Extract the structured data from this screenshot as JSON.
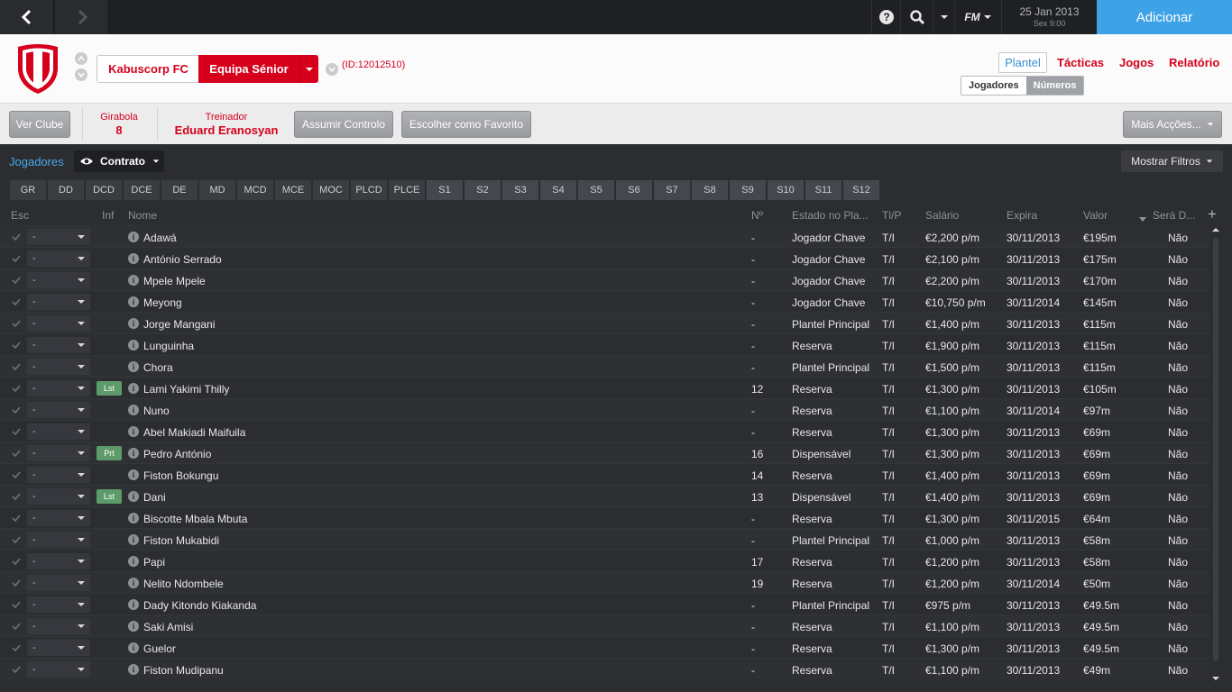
{
  "topbar": {
    "help_icon": "question-icon",
    "search_icon": "search-icon",
    "fm_label": "FM",
    "date": "25 Jan 2013",
    "day_time": "Sex 9:00",
    "add_label": "Adicionar"
  },
  "club": {
    "name": "Kabuscorp FC",
    "team": "Equipa Sénior",
    "id": "(ID:12012510)",
    "tabs": [
      "Plantel",
      "Tácticas",
      "Jogos",
      "Relatório"
    ],
    "subtabs": [
      "Jogadores",
      "Números"
    ]
  },
  "info": {
    "ver_clube": "Ver Clube",
    "league_label": "Girabola",
    "league_value": "8",
    "manager_label": "Treinador",
    "manager_value": "Eduard Eranosyan",
    "assume": "Assumir Controlo",
    "favourite": "Escolher como Favorito",
    "more": "Mais Acções..."
  },
  "filters": {
    "view_label": "Jogadores",
    "view_select": "Contrato",
    "show_filters": "Mostrar Filtros",
    "positions": [
      "GR",
      "DD",
      "DCD",
      "DCE",
      "DE",
      "MD",
      "MCD",
      "MCE",
      "MOC",
      "PLCD",
      "PLCE"
    ],
    "slots": [
      "S1",
      "S2",
      "S3",
      "S4",
      "S5",
      "S6",
      "S7",
      "S8",
      "S9",
      "S10",
      "S11",
      "S12"
    ]
  },
  "table": {
    "headers": {
      "esc": "Esc",
      "inf": "Inf",
      "name": "Nome",
      "num": "Nº",
      "status": "Estado no Pla...",
      "tlp": "Tl/P",
      "salary": "Salário",
      "expires": "Expira",
      "value": "Valor",
      "future": "Será D..."
    },
    "rows": [
      {
        "sel": "-",
        "badge": "",
        "name": "Adawá",
        "num": "-",
        "status": "Jogador Chave",
        "tlp": "T/I",
        "salary": "€2,200 p/m",
        "expires": "30/11/2013",
        "value": "€195m",
        "future": "Não"
      },
      {
        "sel": "-",
        "badge": "",
        "name": "António Serrado",
        "num": "-",
        "status": "Jogador Chave",
        "tlp": "T/I",
        "salary": "€2,100 p/m",
        "expires": "30/11/2013",
        "value": "€175m",
        "future": "Não"
      },
      {
        "sel": "-",
        "badge": "",
        "name": "Mpele Mpele",
        "num": "-",
        "status": "Jogador Chave",
        "tlp": "T/I",
        "salary": "€2,200 p/m",
        "expires": "30/11/2013",
        "value": "€170m",
        "future": "Não"
      },
      {
        "sel": "-",
        "badge": "",
        "name": "Meyong",
        "num": "-",
        "status": "Jogador Chave",
        "tlp": "T/I",
        "salary": "€10,750 p/m",
        "expires": "30/11/2014",
        "value": "€145m",
        "future": "Não"
      },
      {
        "sel": "-",
        "badge": "",
        "name": "Jorge Mangani",
        "num": "-",
        "status": "Plantel Principal",
        "tlp": "T/I",
        "salary": "€1,400 p/m",
        "expires": "30/11/2013",
        "value": "€115m",
        "future": "Não"
      },
      {
        "sel": "-",
        "badge": "",
        "name": "Lunguinha",
        "num": "-",
        "status": "Reserva",
        "tlp": "T/I",
        "salary": "€1,900 p/m",
        "expires": "30/11/2013",
        "value": "€115m",
        "future": "Não"
      },
      {
        "sel": "-",
        "badge": "",
        "name": "Chora",
        "num": "-",
        "status": "Plantel Principal",
        "tlp": "T/I",
        "salary": "€1,500 p/m",
        "expires": "30/11/2013",
        "value": "€115m",
        "future": "Não"
      },
      {
        "sel": "-",
        "badge": "Lst",
        "name": "Lami Yakimi Thilly",
        "num": "12",
        "status": "Reserva",
        "tlp": "T/I",
        "salary": "€1,300 p/m",
        "expires": "30/11/2013",
        "value": "€105m",
        "future": "Não"
      },
      {
        "sel": "-",
        "badge": "",
        "name": "Nuno",
        "num": "-",
        "status": "Reserva",
        "tlp": "T/I",
        "salary": "€1,100 p/m",
        "expires": "30/11/2014",
        "value": "€97m",
        "future": "Não"
      },
      {
        "sel": "-",
        "badge": "",
        "name": "Abel Makiadi Maifuila",
        "num": "-",
        "status": "Reserva",
        "tlp": "T/I",
        "salary": "€1,300 p/m",
        "expires": "30/11/2013",
        "value": "€69m",
        "future": "Não"
      },
      {
        "sel": "-",
        "badge": "Prt",
        "name": "Pedro António",
        "num": "16",
        "status": "Dispensável",
        "tlp": "T/I",
        "salary": "€1,300 p/m",
        "expires": "30/11/2013",
        "value": "€69m",
        "future": "Não"
      },
      {
        "sel": "-",
        "badge": "",
        "name": "Fiston Bokungu",
        "num": "14",
        "status": "Reserva",
        "tlp": "T/I",
        "salary": "€1,400 p/m",
        "expires": "30/11/2013",
        "value": "€69m",
        "future": "Não"
      },
      {
        "sel": "-",
        "badge": "Lst",
        "name": "Dani",
        "num": "13",
        "status": "Dispensável",
        "tlp": "T/I",
        "salary": "€1,400 p/m",
        "expires": "30/11/2013",
        "value": "€69m",
        "future": "Não"
      },
      {
        "sel": "-",
        "badge": "",
        "name": "Biscotte Mbala Mbuta",
        "num": "-",
        "status": "Reserva",
        "tlp": "T/I",
        "salary": "€1,300 p/m",
        "expires": "30/11/2015",
        "value": "€64m",
        "future": "Não"
      },
      {
        "sel": "-",
        "badge": "",
        "name": "Fiston Mukabidi",
        "num": "-",
        "status": "Plantel Principal",
        "tlp": "T/I",
        "salary": "€1,000 p/m",
        "expires": "30/11/2013",
        "value": "€58m",
        "future": "Não"
      },
      {
        "sel": "-",
        "badge": "",
        "name": "Papi",
        "num": "17",
        "status": "Reserva",
        "tlp": "T/I",
        "salary": "€1,200 p/m",
        "expires": "30/11/2013",
        "value": "€58m",
        "future": "Não"
      },
      {
        "sel": "-",
        "badge": "",
        "name": "Nelito Ndombele",
        "num": "19",
        "status": "Reserva",
        "tlp": "T/I",
        "salary": "€1,200 p/m",
        "expires": "30/11/2014",
        "value": "€50m",
        "future": "Não"
      },
      {
        "sel": "-",
        "badge": "",
        "name": "Dady Kitondo Kiakanda",
        "num": "-",
        "status": "Plantel Principal",
        "tlp": "T/I",
        "salary": "€975 p/m",
        "expires": "30/11/2013",
        "value": "€49.5m",
        "future": "Não"
      },
      {
        "sel": "-",
        "badge": "",
        "name": "Saki Amisi",
        "num": "-",
        "status": "Reserva",
        "tlp": "T/I",
        "salary": "€1,100 p/m",
        "expires": "30/11/2013",
        "value": "€49.5m",
        "future": "Não"
      },
      {
        "sel": "-",
        "badge": "",
        "name": "Guelor",
        "num": "-",
        "status": "Reserva",
        "tlp": "T/I",
        "salary": "€1,300 p/m",
        "expires": "30/11/2013",
        "value": "€49.5m",
        "future": "Não"
      },
      {
        "sel": "-",
        "badge": "",
        "name": "Fiston Mudipanu",
        "num": "-",
        "status": "Reserva",
        "tlp": "T/I",
        "salary": "€1,100 p/m",
        "expires": "30/11/2013",
        "value": "€49m",
        "future": "Não"
      }
    ]
  },
  "colors": {
    "accent_red": "#d6001c",
    "accent_blue": "#3ea2e6",
    "badge_green": "#5e9b6a"
  }
}
